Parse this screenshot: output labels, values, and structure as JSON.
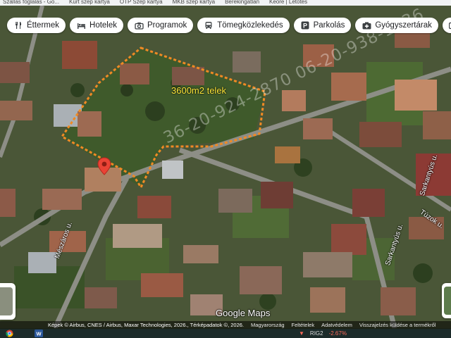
{
  "bookmarks": [
    "Szállás foglalás - Go...",
    "Kürt szép kártya",
    "OTP Szép kártya",
    "MKB szép kártya",
    "Berekingatlan",
    "Keore | Létotés"
  ],
  "chips": [
    {
      "icon": "fork-knife-icon",
      "label": "Éttermek"
    },
    {
      "icon": "bed-icon",
      "label": "Hotelek"
    },
    {
      "icon": "camera-icon",
      "label": "Programok"
    },
    {
      "icon": "bus-icon",
      "label": "Tömegközlekedés"
    },
    {
      "icon": "parking-icon",
      "label": "Parkolás"
    },
    {
      "icon": "pharmacy-icon",
      "label": "Gyógyszertárak"
    },
    {
      "icon": "atm-icon",
      "label": "AT"
    }
  ],
  "map": {
    "parcel_label": "3600m2 telek",
    "watermark": "36-20-924-2870 06-20-938-1636",
    "parcel_outline_color": "#f08a24",
    "pin_color": "#ea4335",
    "streets": {
      "meszaros": "Mészáros u.",
      "sarkantyus_top": "Sarkantyús u.",
      "sarkantyus_bottom": "Sarkantyús u.",
      "tuzok": "Túzok u."
    },
    "logo": "Google Maps",
    "attribution": {
      "imagery": "Képek © Airbus, CNES / Airbus, Maxar Technologies, 2026., Térképadatok ©, 2026.",
      "country": "Magyarország",
      "terms": "Feltételek",
      "privacy": "Adatvédelem",
      "feedback": "Visszajelzés küldése a termékről"
    }
  },
  "taskbar": {
    "ticker_symbol": "RIG2",
    "ticker_change": "-2.67%"
  }
}
